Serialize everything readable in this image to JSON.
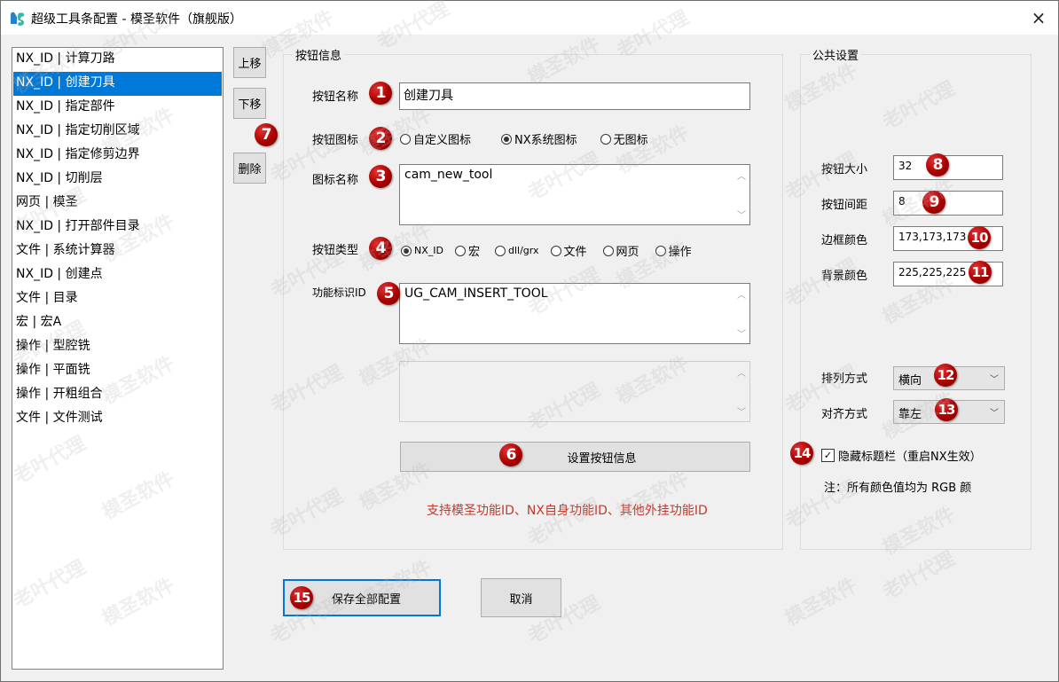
{
  "window": {
    "title": "超级工具条配置 - 模圣软件（旗舰版）",
    "close_icon": "×"
  },
  "list": {
    "items": [
      {
        "label": "NX_ID | 计算刀路",
        "selected": false
      },
      {
        "label": "NX_ID | 创建刀具",
        "selected": true
      },
      {
        "label": "NX_ID | 指定部件",
        "selected": false
      },
      {
        "label": "NX_ID | 指定切削区域",
        "selected": false
      },
      {
        "label": "NX_ID | 指定修剪边界",
        "selected": false
      },
      {
        "label": "NX_ID | 切削层",
        "selected": false
      },
      {
        "label": "网页 | 模圣",
        "selected": false
      },
      {
        "label": "NX_ID | 打开部件目录",
        "selected": false
      },
      {
        "label": "文件 | 系统计算器",
        "selected": false
      },
      {
        "label": "NX_ID | 创建点",
        "selected": false
      },
      {
        "label": "文件 | 目录",
        "selected": false
      },
      {
        "label": "宏 | 宏A",
        "selected": false
      },
      {
        "label": "操作 | 型腔铣",
        "selected": false
      },
      {
        "label": "操作 | 平面铣",
        "selected": false
      },
      {
        "label": "操作 | 开粗组合",
        "selected": false
      },
      {
        "label": "文件 | 文件测试",
        "selected": false
      }
    ],
    "move_up_label": "上移",
    "move_down_label": "下移",
    "delete_label": "删除"
  },
  "button_info": {
    "group_title": "按钮信息",
    "name_label": "按钮名称",
    "name_value": "创建刀具",
    "icon_label": "按钮图标",
    "icon_options": [
      {
        "label": "自定义图标",
        "checked": false
      },
      {
        "label": "NX系统图标",
        "checked": true
      },
      {
        "label": "无图标",
        "checked": false
      }
    ],
    "icon_name_label": "图标名称",
    "icon_name_value": "cam_new_tool",
    "type_label": "按钮类型",
    "type_options": [
      {
        "label": "NX_ID",
        "checked": true
      },
      {
        "label": "宏",
        "checked": false
      },
      {
        "label": "dll/grx",
        "checked": false
      },
      {
        "label": "文件",
        "checked": false
      },
      {
        "label": "网页",
        "checked": false
      },
      {
        "label": "操作",
        "checked": false
      }
    ],
    "func_id_label": "功能标识ID",
    "func_id_value": "UG_CAM_INSERT_TOOL",
    "extra_value": "",
    "set_button_label": "设置按钮信息",
    "hint": "支持模圣功能ID、NX自身功能ID、其他外挂功能ID"
  },
  "public_settings": {
    "group_title": "公共设置",
    "size_label": "按钮大小",
    "size_value": "32",
    "spacing_label": "按钮间距",
    "spacing_value": "8",
    "border_color_label": "边框颜色",
    "border_color_value": "173,173,173",
    "bg_color_label": "背景颜色",
    "bg_color_value": "225,225,225",
    "arrange_label": "排列方式",
    "arrange_value": "横向",
    "align_label": "对齐方式",
    "align_value": "靠左",
    "hide_titlebar_label": "隐藏标题栏（重启NX生效）",
    "hide_titlebar_checked": true,
    "note": "注：所有颜色值均为 RGB 颜"
  },
  "footer": {
    "save_label": "保存全部配置",
    "cancel_label": "取消"
  },
  "badges": [
    "1",
    "2",
    "3",
    "4",
    "5",
    "6",
    "7",
    "8",
    "9",
    "10",
    "11",
    "12",
    "13",
    "14",
    "15"
  ],
  "watermarks": [
    "模圣软件",
    "老叶代理"
  ],
  "colors": {
    "selection": "#0078d7",
    "hint_text": "#c0392b",
    "badge": "#a00000"
  }
}
